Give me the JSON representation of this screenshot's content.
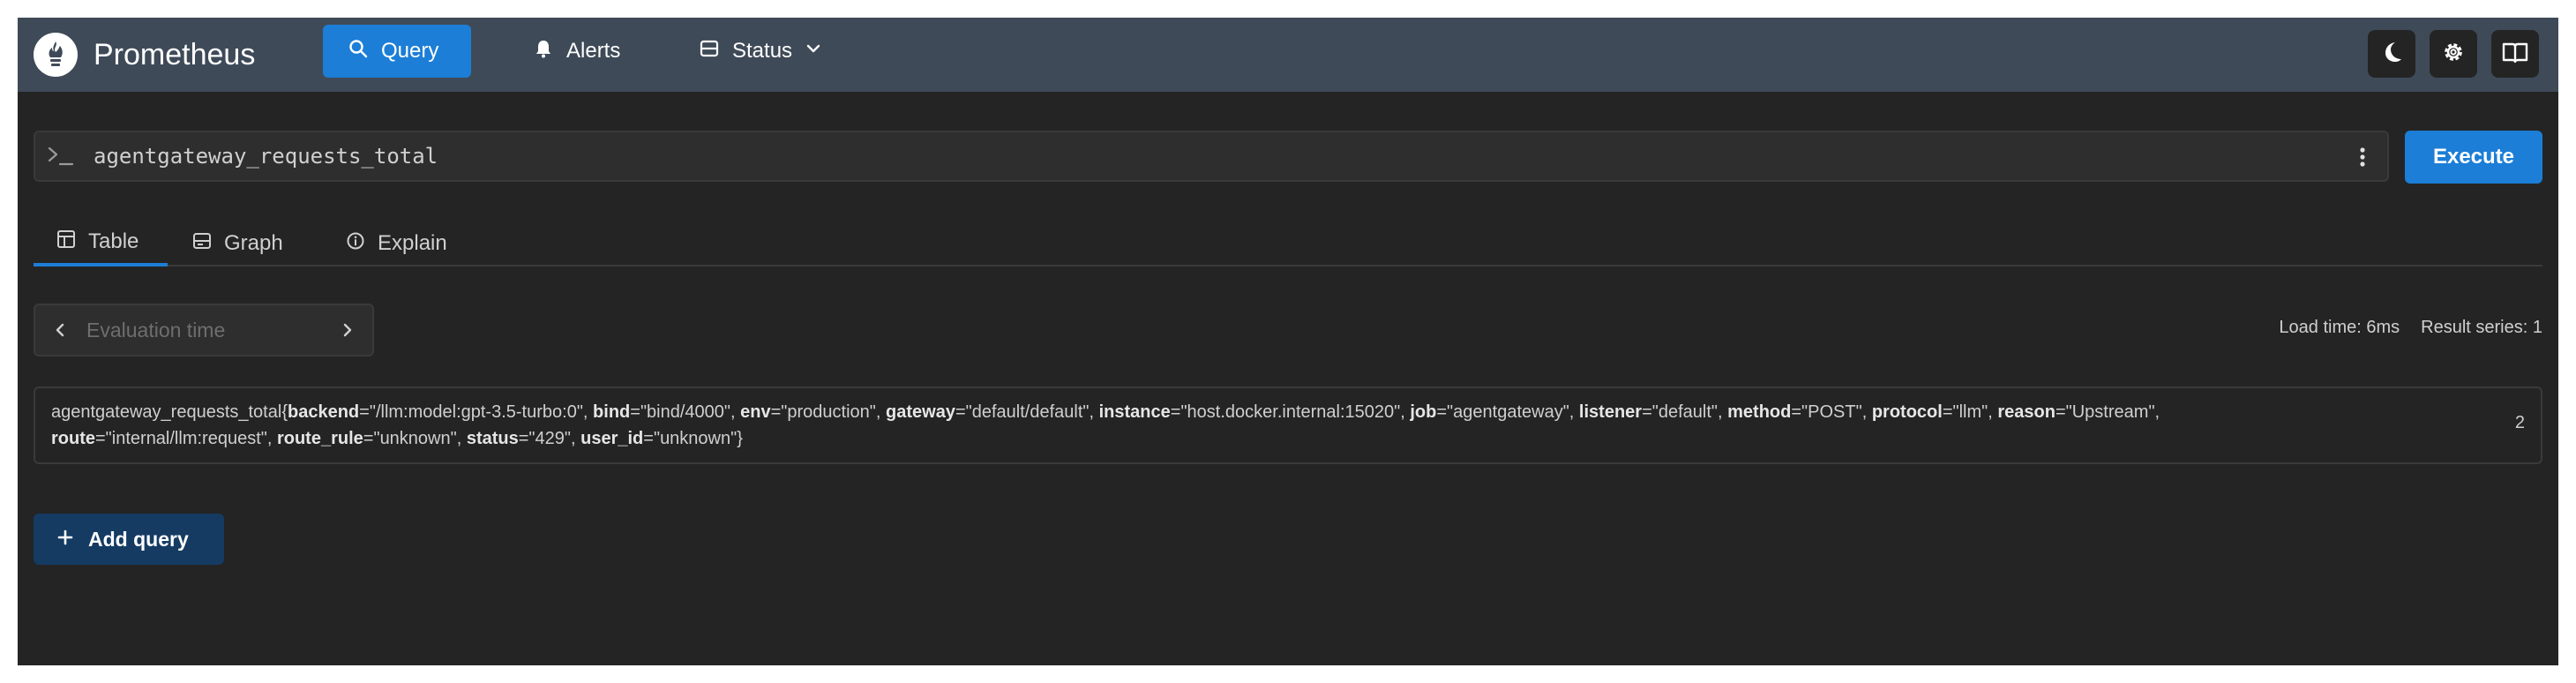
{
  "header": {
    "brand": "Prometheus",
    "nav": {
      "query": "Query",
      "alerts": "Alerts",
      "status": "Status"
    },
    "icons": {
      "logo": "prometheus-flame-icon",
      "query": "search-icon",
      "alerts": "bell-icon",
      "status": "server-icon",
      "theme": "moon-icon",
      "settings": "gear-icon",
      "docs": "book-icon"
    },
    "colors": {
      "header_bg": "#3f4a58",
      "accent": "#1c7ed6"
    }
  },
  "query": {
    "expression": "agentgateway_requests_total",
    "execute_label": "Execute"
  },
  "tabs": {
    "table": "Table",
    "graph": "Graph",
    "explain": "Explain",
    "active": "Table"
  },
  "evaluation": {
    "placeholder": "Evaluation time"
  },
  "stats": {
    "load_time": "Load time: 6ms",
    "result_series": "Result series: 1"
  },
  "result": {
    "metric": "agentgateway_requests_total",
    "labels": [
      {
        "name": "backend",
        "value": "/llm:model:gpt-3.5-turbo:0"
      },
      {
        "name": "bind",
        "value": "bind/4000"
      },
      {
        "name": "env",
        "value": "production"
      },
      {
        "name": "gateway",
        "value": "default/default"
      },
      {
        "name": "instance",
        "value": "host.docker.internal:15020"
      },
      {
        "name": "job",
        "value": "agentgateway"
      },
      {
        "name": "listener",
        "value": "default"
      },
      {
        "name": "method",
        "value": "POST"
      },
      {
        "name": "protocol",
        "value": "llm"
      },
      {
        "name": "reason",
        "value": "Upstream"
      },
      {
        "name": "route",
        "value": "internal/llm:request"
      },
      {
        "name": "route_rule",
        "value": "unknown"
      },
      {
        "name": "status",
        "value": "429"
      },
      {
        "name": "user_id",
        "value": "unknown"
      }
    ],
    "value": "2"
  },
  "add_query_label": "Add query"
}
